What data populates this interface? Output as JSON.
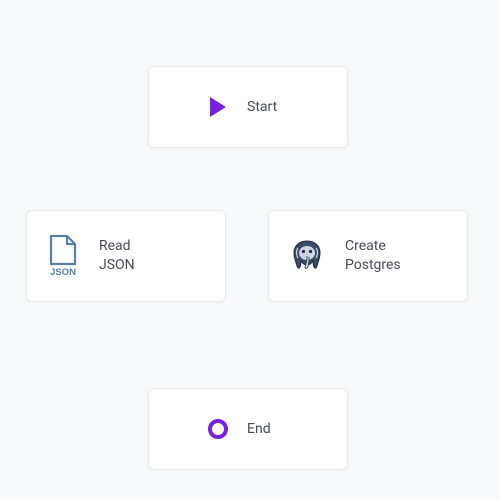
{
  "nodes": {
    "start": {
      "label": "Start"
    },
    "read_json": {
      "label": "Read\nJSON"
    },
    "create_postgres": {
      "label": "Create\nPostgres"
    },
    "end": {
      "label": "End"
    }
  },
  "colors": {
    "accent_purple": "#7b1fe0",
    "json_blue": "#5a7fa8",
    "postgres_dark": "#3a4b6a"
  }
}
